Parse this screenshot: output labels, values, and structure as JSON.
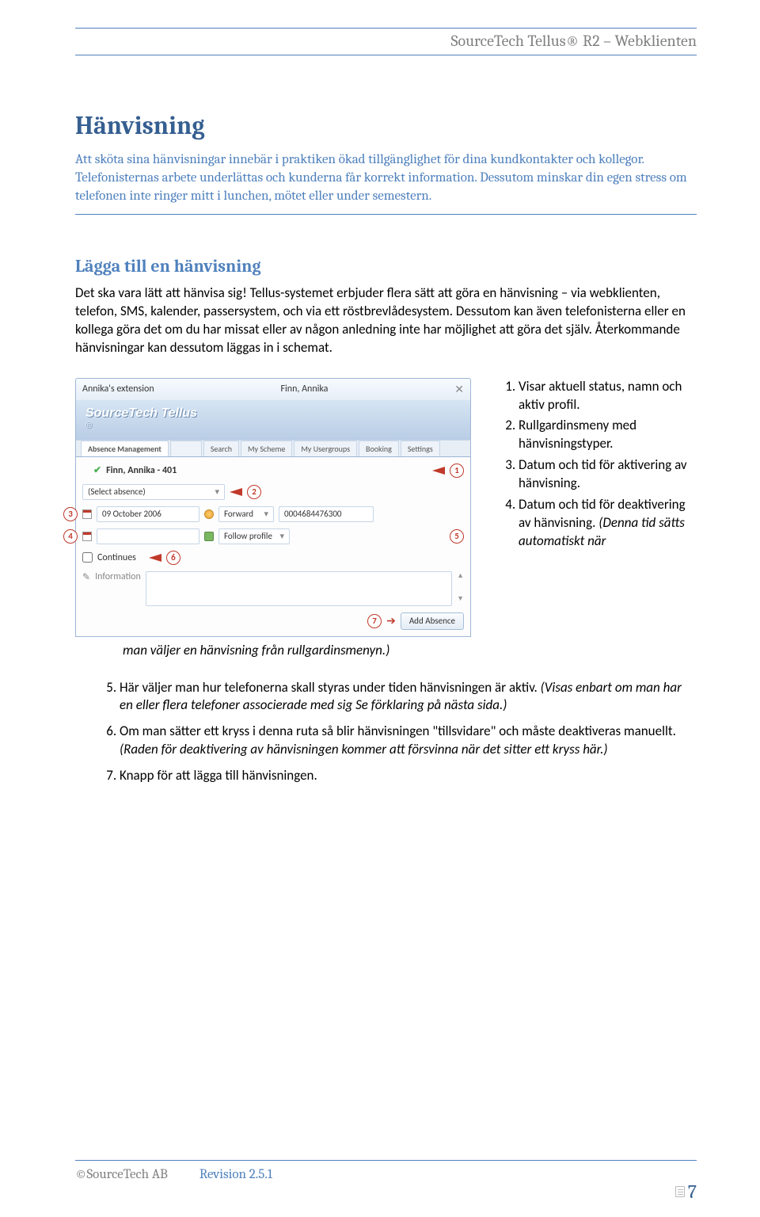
{
  "header": {
    "title": "SourceTech Tellus® R2 – Webklienten"
  },
  "section": {
    "heading": "Hänvisning",
    "intro": "Att sköta sina hänvisningar innebär i praktiken ökad tillgänglighet för dina kundkontakter och kollegor. Telefonisternas arbete underlättas och kunderna får korrekt information. Dessutom minskar din egen stress om telefonen inte ringer mitt i lunchen, mötet eller under semestern."
  },
  "subsection": {
    "heading": "Lägga till en hänvisning",
    "p1": "Det ska vara lätt att hänvisa sig! Tellus-systemet erbjuder flera sätt att göra en hänvisning – via webklienten, telefon, SMS, kalender, passersystem, och via ett röstbrevlådesystem. Dessutom kan även telefonisterna eller en kollega göra det om du har missat eller av någon anledning inte har möjlighet att göra det själv. Återkommande hänvisningar kan dessutom läggas in i schemat."
  },
  "screenshot": {
    "window_left": "Annika's extension",
    "window_title": "Finn, Annika",
    "brand": "SourceTech Tellus",
    "brand_sub": "®",
    "tabs": [
      "Absence Management",
      "",
      "Search",
      "My Scheme",
      "My Usergroups",
      "Booking",
      "Settings"
    ],
    "row1_text": "Finn, Annika - 401",
    "row2_text": "(Select absence)",
    "row3_date": "09 October 2006",
    "row3_forward": "Forward",
    "row3_number": "0004684476300",
    "row4_follow": "Follow profile",
    "row5_continues": "Continues",
    "row6_info": "Information",
    "add_button": "Add Absence",
    "markers": [
      "1",
      "2",
      "3",
      "4",
      "5",
      "6",
      "7"
    ]
  },
  "sidelist": {
    "items": [
      "Visar aktuell status, namn och aktiv profil.",
      "Rullgardinsmeny med hänvisningstyper.",
      "Datum och tid för aktivering av hänvisning.",
      "Datum och tid för deaktivering av hänvisning."
    ],
    "item4_tail_italic": "(Denna tid sätts automatiskt när",
    "trail_after": "man väljer en hänvisning från rullgardinsmenyn.)"
  },
  "contlist": {
    "item5a": " Här väljer man hur telefonerna skall styras under tiden hänvisningen är aktiv. ",
    "item5b_italic": "(Visas enbart om man har en eller flera telefoner associerade med sig Se förklaring på nästa sida.)",
    "item6a": "Om man sätter ett kryss i denna ruta så blir hänvisningen \"tillsvidare\" och måste deaktiveras manuellt. ",
    "item6b_italic": "(Raden för deaktivering av hänvisningen kommer att försvinna när det sitter ett kryss här.)",
    "item7": "Knapp för att lägga till hänvisningen."
  },
  "footer": {
    "copyright": "©SourceTech AB",
    "revision": "Revision 2.5.1",
    "page": "7"
  }
}
